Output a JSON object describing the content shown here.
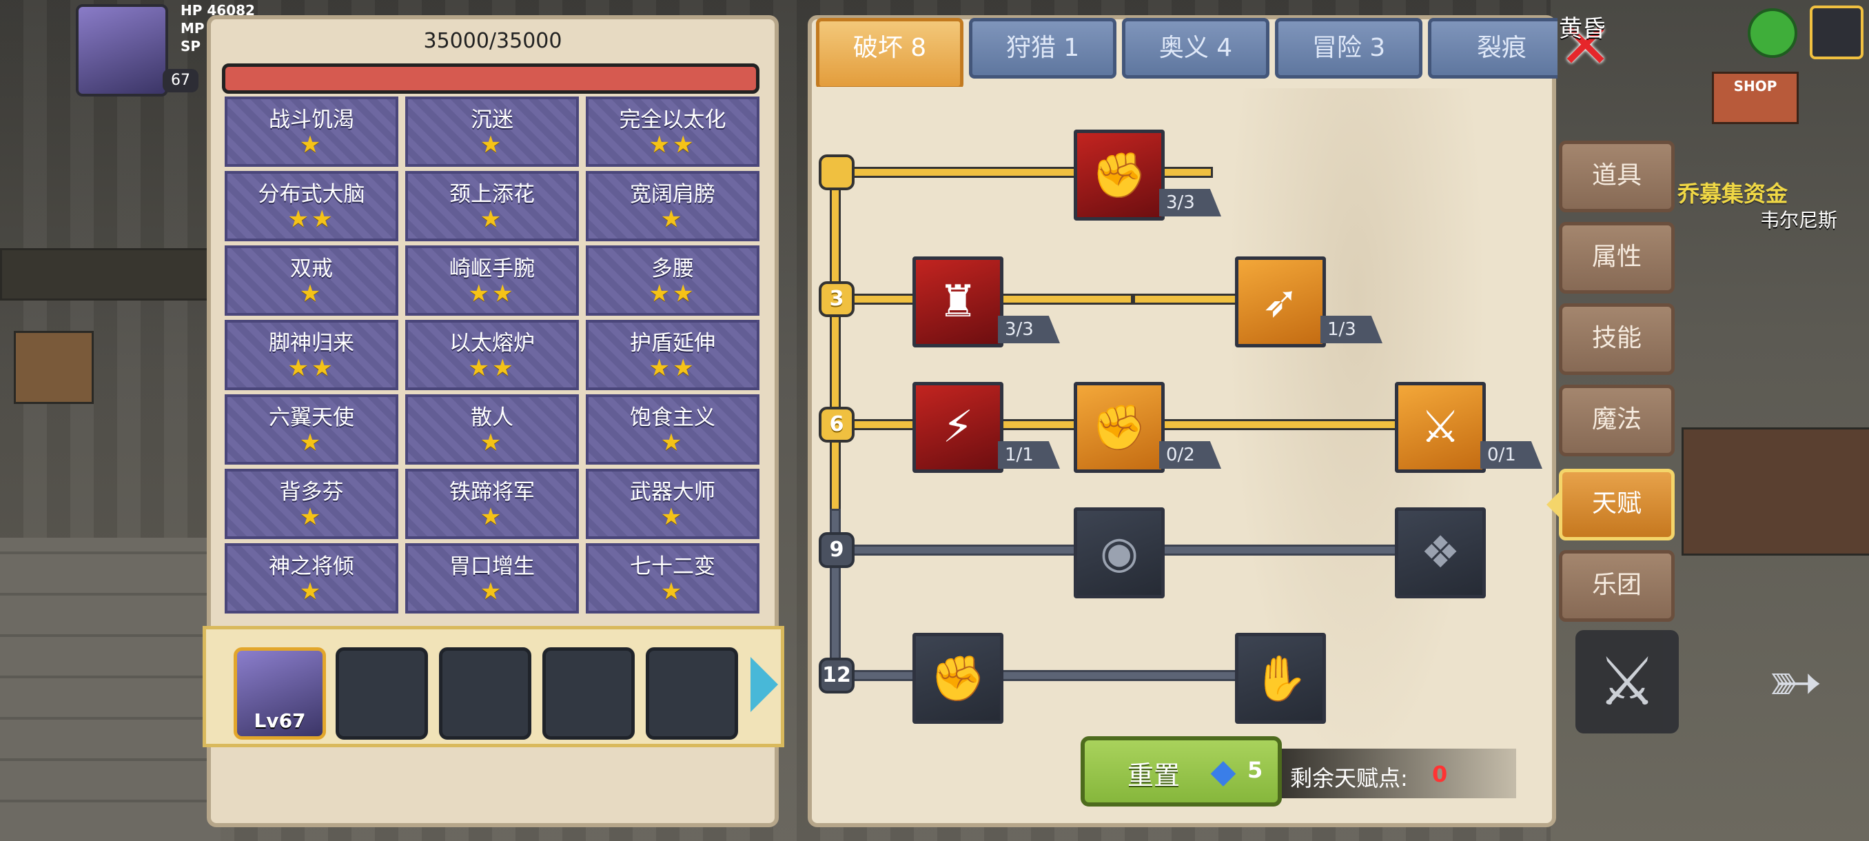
{
  "hud": {
    "stats": [
      "HP 46082",
      "MP",
      "SP"
    ],
    "level": "67"
  },
  "hp": {
    "text": "35000/35000",
    "fill_fraction": 1.0,
    "color": "#d65a50"
  },
  "talents": [
    {
      "name": "战斗饥渴",
      "stars": "★"
    },
    {
      "name": "沉迷",
      "stars": "★"
    },
    {
      "name": "完全以太化",
      "stars": "★★"
    },
    {
      "name": "分布式大脑",
      "stars": "★★"
    },
    {
      "name": "颈上添花",
      "stars": "★"
    },
    {
      "name": "宽阔肩膀",
      "stars": "★"
    },
    {
      "name": "双戒",
      "stars": "★"
    },
    {
      "name": "崎岖手腕",
      "stars": "★★"
    },
    {
      "name": "多腰",
      "stars": "★★"
    },
    {
      "name": "脚神归来",
      "stars": "★★"
    },
    {
      "name": "以太熔炉",
      "stars": "★★"
    },
    {
      "name": "护盾延伸",
      "stars": "★★"
    },
    {
      "name": "六翼天使",
      "stars": "★"
    },
    {
      "name": "散人",
      "stars": "★"
    },
    {
      "name": "饱食主义",
      "stars": "★"
    },
    {
      "name": "背多芬",
      "stars": "★"
    },
    {
      "name": "铁蹄将军",
      "stars": "★"
    },
    {
      "name": "武器大师",
      "stars": "★"
    },
    {
      "name": "神之将倾",
      "stars": "★"
    },
    {
      "name": "胃口增生",
      "stars": "★"
    },
    {
      "name": "七十二变",
      "stars": "★"
    }
  ],
  "team": {
    "hero_level": "Lv67",
    "next_icon": "chevron-right-icon"
  },
  "tabs": [
    "破坏 8",
    "狩猎 1",
    "奥义 4",
    "冒险 3",
    "裂痕"
  ],
  "close_icon": "close-icon",
  "tree": {
    "tiers": [
      "",
      "3",
      "6",
      "9",
      "12"
    ],
    "nodes": [
      {
        "name": "arm-wrestle-icon",
        "count": "3/3",
        "style": "red",
        "glyph": "✊"
      },
      {
        "name": "muscle-body-icon",
        "count": "3/3",
        "style": "red",
        "glyph": "♜"
      },
      {
        "name": "arrow-hit-icon",
        "count": "1/3",
        "style": "orange",
        "glyph": "➶"
      },
      {
        "name": "dash-strike-icon",
        "count": "1/1",
        "style": "red",
        "glyph": "⚡"
      },
      {
        "name": "fist-icon",
        "count": "0/2",
        "style": "orange",
        "glyph": "✊"
      },
      {
        "name": "blade-splash-icon",
        "count": "0/1",
        "style": "orange",
        "glyph": "⚔"
      },
      {
        "name": "ripple-icon",
        "count": "",
        "style": "dark",
        "glyph": "◉"
      },
      {
        "name": "bat-wings-icon",
        "count": "",
        "style": "dark",
        "glyph": "❖"
      },
      {
        "name": "raised-fist-icon",
        "count": "",
        "style": "dark",
        "glyph": "✊"
      },
      {
        "name": "grip-hand-icon",
        "count": "",
        "style": "dark",
        "glyph": "✋"
      }
    ]
  },
  "reset": {
    "label": "重置",
    "cost": "5",
    "gem_icon": "diamond-icon"
  },
  "points": {
    "label": "剩余天赋点:",
    "value": "0"
  },
  "sidebar": [
    "道具",
    "属性",
    "技能",
    "魔法",
    "天赋",
    "乐团"
  ],
  "background_text": {
    "banner": "乔募集资金",
    "npc": "韦尔尼斯",
    "shop": "SHOP",
    "top": "黄昏"
  },
  "colors": {
    "accent": "#f0c040",
    "active_tab": "#e39d3c",
    "inactive_tab": "#6f86ad",
    "tile": "#6b659c",
    "close": "#e6262a",
    "points_value": "#ff3333"
  }
}
